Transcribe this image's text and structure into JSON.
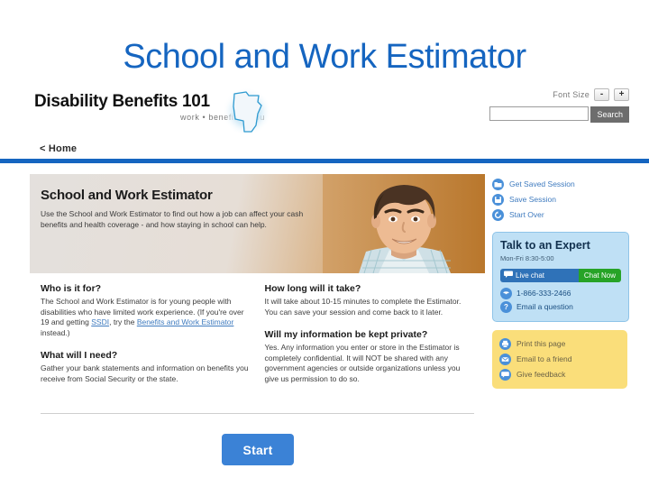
{
  "slide": {
    "title": "School and Work Estimator",
    "title_color": "#1565c0"
  },
  "header": {
    "logo_title": "Disability Benefits 101",
    "logo_tagline": "work • benefits • you",
    "state_outline": "minnesota-state-icon",
    "font_size_label": "Font Size",
    "font_decrease": "-",
    "font_increase": "+",
    "search_value": "",
    "search_placeholder": "",
    "search_button": "Search"
  },
  "breadcrumb": {
    "home": "< Home"
  },
  "hero": {
    "title": "School and Work Estimator",
    "subtitle": "Use the School and Work Estimator to find out how a job can affect your cash benefits and health coverage - and how staying in school can help.",
    "photo_alt": "smiling-young-man-photo"
  },
  "faq": {
    "left": [
      {
        "heading": "Who is it for?",
        "body_1": "The School and Work Estimator is for young people with disabilities who have limited work experience. (If you're over 19 and getting ",
        "link_1": "SSDI",
        "body_2": ", try the ",
        "link_2": "Benefits and Work Estimator",
        "body_3": " instead.)"
      },
      {
        "heading": "What will I need?",
        "body_1": "Gather your bank statements and information on benefits you receive from Social Security or the state.",
        "link_1": "",
        "body_2": "",
        "link_2": "",
        "body_3": ""
      }
    ],
    "right": [
      {
        "heading": "How long will it take?",
        "body_1": "It will take about 10-15 minutes to complete the Estimator. You can save your session and come back to it later.",
        "link_1": "",
        "body_2": "",
        "link_2": "",
        "body_3": ""
      },
      {
        "heading": "Will my information be kept private?",
        "body_1": "Yes. Any information you enter or store in the Estimator is completely confidential. It will NOT be shared with any government agencies or outside organizations unless you give us permission to do so.",
        "link_1": "",
        "body_2": "",
        "link_2": "",
        "body_3": ""
      }
    ]
  },
  "start_button": {
    "label": "Start"
  },
  "sidebar": {
    "session_actions": [
      {
        "label": "Get Saved Session",
        "icon": "folder-icon"
      },
      {
        "label": "Save Session",
        "icon": "save-disk-icon"
      },
      {
        "label": "Start Over",
        "icon": "refresh-icon"
      }
    ],
    "expert": {
      "title": "Talk to an Expert",
      "hours": "Mon-Fri 8:30-5:00",
      "live_chat_label": "Live chat",
      "chat_now_label": "Chat Now",
      "phone": "1-866-333-2466",
      "email_label": "Email a question",
      "box_color": "#bfe0f5",
      "chat_now_color": "#27a327"
    },
    "tools": [
      {
        "label": "Print this page",
        "icon": "printer-icon"
      },
      {
        "label": "Email to a friend",
        "icon": "envelope-icon"
      },
      {
        "label": "Give feedback",
        "icon": "speech-bubble-icon"
      }
    ],
    "tools_box_color": "#fade7a"
  }
}
